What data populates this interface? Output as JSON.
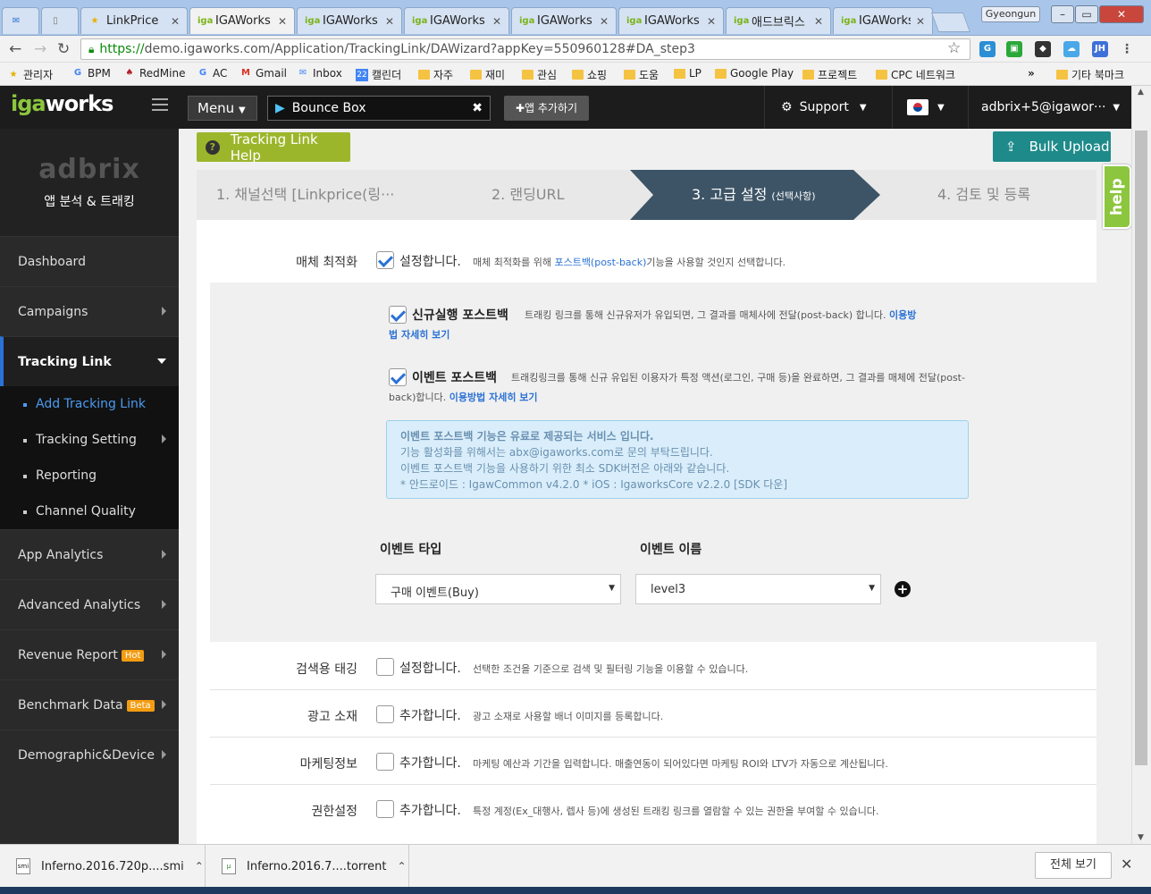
{
  "browser": {
    "tabs": [
      {
        "title": "",
        "icon": "mail-icon"
      },
      {
        "title": "",
        "icon": "page-icon"
      },
      {
        "title": "LinkPrice",
        "icon": "star-icon"
      },
      {
        "title": "IGAWorks",
        "icon": "igaworks-icon",
        "active": true
      },
      {
        "title": "IGAWorks",
        "icon": "igaworks-icon"
      },
      {
        "title": "IGAWorks",
        "icon": "igaworks-icon"
      },
      {
        "title": "IGAWorks",
        "icon": "igaworks-icon"
      },
      {
        "title": "IGAWorks",
        "icon": "igaworks-icon"
      },
      {
        "title": "애드브릭스",
        "icon": "igaworks-icon"
      },
      {
        "title": "IGAWorks",
        "icon": "igaworks-icon"
      }
    ],
    "window_user": "Gyeongun",
    "url_scheme": "https://",
    "url_rest": "demo.igaworks.com/Application/TrackingLink/DAWizard?appKey=550960128#DA_step3",
    "bookmarks": [
      {
        "label": "관리자",
        "icon": "star-icon"
      },
      {
        "label": "BPM",
        "icon": "google-icon"
      },
      {
        "label": "RedMine",
        "icon": "redmine-icon"
      },
      {
        "label": "AC",
        "icon": "google-icon"
      },
      {
        "label": "Gmail",
        "icon": "gmail-icon"
      },
      {
        "label": "Inbox",
        "icon": "inbox-icon"
      },
      {
        "label": "캘린더",
        "icon": "calendar-icon",
        "badge": "22"
      },
      {
        "label": "자주",
        "icon": "folder-icon"
      },
      {
        "label": "재미",
        "icon": "folder-icon"
      },
      {
        "label": "관심",
        "icon": "folder-icon"
      },
      {
        "label": "쇼핑",
        "icon": "folder-icon"
      },
      {
        "label": "도움",
        "icon": "folder-icon"
      },
      {
        "label": "LP",
        "icon": "folder-icon"
      },
      {
        "label": "Google Play",
        "icon": "folder-icon"
      },
      {
        "label": "프로젝트",
        "icon": "folder-icon"
      },
      {
        "label": "CPC 네트워크",
        "icon": "folder-icon"
      }
    ],
    "bookmarks_more": "»",
    "other_bookmarks": "기타 북마크"
  },
  "header": {
    "logo_g": "iga",
    "logo_rest": "works",
    "menu_label": "Menu",
    "app_name": "Bounce Box",
    "add_app_label": "앱 추가하기",
    "support_label": "Support",
    "user_label": "adbrix+5@igawor···"
  },
  "sidebar": {
    "brand": "adbrix",
    "subtitle": "앱 분석 & 트래킹",
    "items": [
      {
        "label": "Dashboard"
      },
      {
        "label": "Campaigns"
      },
      {
        "label": "Tracking Link"
      },
      {
        "label": "App Analytics"
      },
      {
        "label": "Advanced Analytics"
      },
      {
        "label": "Revenue Report",
        "badge": "Hot",
        "badge_color": "#f39c12"
      },
      {
        "label": "Benchmark Data",
        "badge": "Beta",
        "badge_color": "#f39c12"
      },
      {
        "label": "Demographic&Device"
      }
    ],
    "sub_items": [
      {
        "label": "Add Tracking Link"
      },
      {
        "label": "Tracking Setting"
      },
      {
        "label": "Reporting"
      },
      {
        "label": "Channel Quality"
      }
    ]
  },
  "main": {
    "help_button": "Tracking Link Help",
    "bulk_upload": "Bulk Upload",
    "help_tab": "help",
    "steps": [
      {
        "label": "1. 채널선택 [Linkprice(링···"
      },
      {
        "label": "2. 랜딩URL"
      },
      {
        "label": "3. 고급 설정",
        "small": "(선택사항)"
      },
      {
        "label": "4. 검토 및 등록"
      }
    ],
    "media_opt": {
      "label": "매체 최적화",
      "checkbox_text": "설정합니다.",
      "desc_pre": "매체 최적화를 위해 ",
      "desc_link": "포스트백(post-back)",
      "desc_post": "기능을 사용할 것인지 선택합니다."
    },
    "install_pb": {
      "title": "신규실행 포스트백",
      "desc_line1": "트래킹 링크를 통해 신규유저가 유입되면, 그 결과를 매체사에 전달(post-back) 합니다.",
      "desc_link1": "이용방",
      "desc_link2": "법 자세히 보기"
    },
    "event_pb": {
      "title": "이벤트 포스트백",
      "desc_line1": "트래킹링크를 통해 신규 유입된 이용자가 특정 액션(로그인, 구매 등)을 완료하면, 그 결과를 매체에 전달(post-",
      "desc_line2_pre": "back)합니다.",
      "desc_link": "이용방법 자세히 보기"
    },
    "info": {
      "line1": "이벤트 포스트백 기능은 유료로 제공되는 서비스 입니다.",
      "line2_pre": "기능 활성화를 위해서는 ",
      "line2_email": "abx@igaworks.com",
      "line2_post": "로 문의 부탁드립니다.",
      "line3": "이벤트 포스트백 기능을 사용하기 위한 최소 SDK버전은 아래와 같습니다.",
      "line4": "* 안드로이드 : IgawCommon v4.2.0   * iOS : IgaworksCore v2.2.0  [SDK 다운]"
    },
    "event_type_label": "이벤트 타입",
    "event_name_label": "이벤트 이름",
    "event_type_value": "구매 이벤트(Buy)",
    "event_name_value": "level3",
    "rows": [
      {
        "label": "검색용 태깅",
        "cb": "설정합니다.",
        "desc": "선택한 조건을 기준으로 검색 및 필터링 기능을 이용할 수 있습니다."
      },
      {
        "label": "광고 소재",
        "cb": "추가합니다.",
        "desc": "광고 소재로 사용할 배너 이미지를 등록합니다."
      },
      {
        "label": "마케팅정보",
        "cb": "추가합니다.",
        "desc": "마케팅 예산과 기간을 입력합니다. 매출연동이 되어있다면 마케팅 ROI와 LTV가 자동으로 계산됩니다."
      },
      {
        "label": "권한설정",
        "cb": "추가합니다.",
        "desc": "특정 계정(Ex_대행사, 렙사 등)에 생성된 트래킹 링크를 열람할 수 있는 권한을 부여할 수 있습니다."
      }
    ]
  },
  "downloads": {
    "items": [
      {
        "name": "Inferno.2016.720p....smi",
        "icon": "file-icon"
      },
      {
        "name": "Inferno.2016.7....torrent",
        "icon": "torrent-icon"
      }
    ],
    "show_all": "전체 보기"
  },
  "colors": {
    "accent_blue": "#2a72d5",
    "help_green": "#9cb62c",
    "bulk_teal": "#1f8a8a",
    "wizard_active": "#3d5466"
  }
}
